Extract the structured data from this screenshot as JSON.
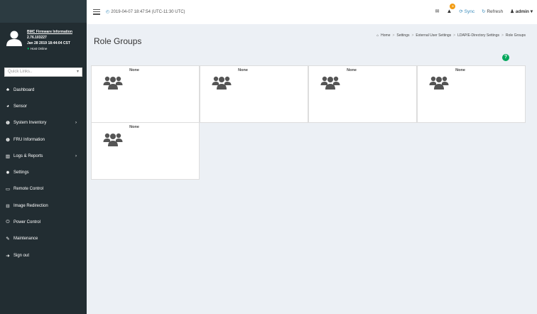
{
  "header": {
    "datetime": "2019-04-07 18:47:54 (UTC-11:30 UTC)",
    "alert_count": "0",
    "sync_label": "Sync",
    "refresh_label": "Refresh",
    "user_label": "admin"
  },
  "sidebar": {
    "firmware_link": "BMC Firmware Information",
    "firmware_version": "2.76.103227",
    "firmware_date": "Jan 28 2019 18:44:04 CST",
    "host_status": "Host Online",
    "quick_links_placeholder": "Quick Links..",
    "items": [
      {
        "label": "Dashboard",
        "icon": "tachometer-icon"
      },
      {
        "label": "Sensor",
        "icon": "gauge-icon"
      },
      {
        "label": "System Inventory",
        "icon": "info-icon"
      },
      {
        "label": "FRU Information",
        "icon": "info-icon"
      },
      {
        "label": "Logs & Reports",
        "icon": "chart-icon"
      },
      {
        "label": "Settings",
        "icon": "gear-icon"
      },
      {
        "label": "Remote Control",
        "icon": "monitor-icon"
      },
      {
        "label": "Image Redirection",
        "icon": "disk-icon"
      },
      {
        "label": "Power Control",
        "icon": "power-icon"
      },
      {
        "label": "Maintenance",
        "icon": "wrench-icon"
      },
      {
        "label": "Sign out",
        "icon": "sign-out-icon"
      }
    ]
  },
  "page": {
    "title": "Role Groups",
    "breadcrumb": [
      "Home",
      "Settings",
      "External User Settings",
      "LDAP/E-Directory Settings",
      "Role Groups"
    ]
  },
  "role_groups": [
    {
      "name": "None"
    },
    {
      "name": "None"
    },
    {
      "name": "None"
    },
    {
      "name": "None"
    },
    {
      "name": "None"
    }
  ],
  "colors": {
    "sidebar_bg": "#222d32",
    "accent": "#3c8dbc",
    "help_green": "#00a65a",
    "badge_orange": "#f39c12"
  }
}
